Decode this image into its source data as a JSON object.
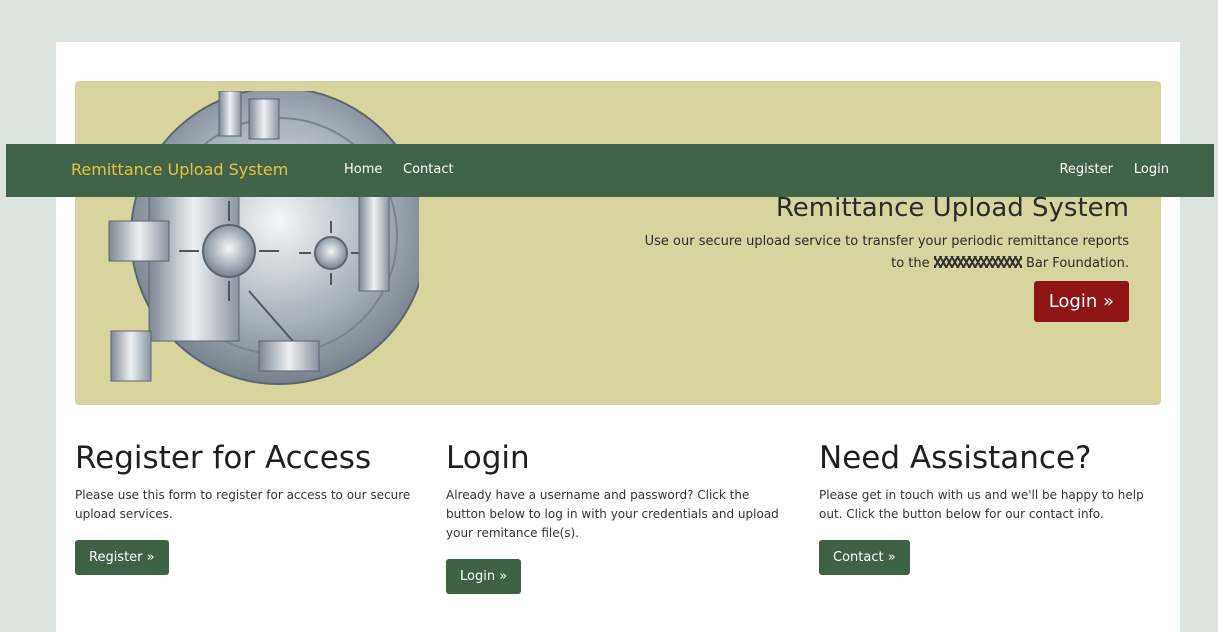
{
  "navbar": {
    "brand": "Remittance Upload System",
    "links_left": [
      "Home",
      "Contact"
    ],
    "links_right": [
      "Register",
      "Login"
    ]
  },
  "hero": {
    "title": "Remittance Upload System",
    "text_before": "Use our secure upload service to transfer your periodic remittance reports to the",
    "text_after": "Bar Foundation.",
    "button": "Login »"
  },
  "columns": [
    {
      "heading": "Register for Access",
      "text": "Please use this form to register for access to our secure upload services.",
      "button": "Register »"
    },
    {
      "heading": "Login",
      "text": "Already have a username and password? Click the button below to log in with your credentials and upload your remitance file(s).",
      "button": "Login »"
    },
    {
      "heading": "Need Assistance?",
      "text": "Please get in touch with us and we'll be happy to help out. Click the button below for our contact info.",
      "button": "Contact »"
    }
  ],
  "colors": {
    "navbar": "#41634a",
    "brand": "#e8c340",
    "hero_background": "#d8d49d",
    "hero_button": "#8f1414",
    "column_button": "#3f6246"
  }
}
